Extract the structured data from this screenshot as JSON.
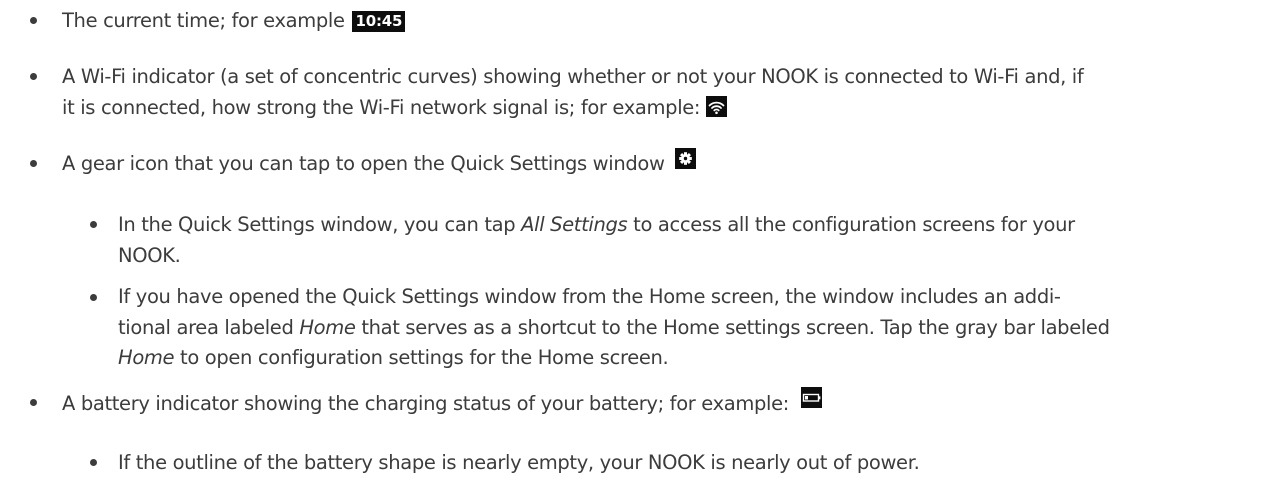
{
  "items": [
    {
      "text": "The current time; for example ",
      "badge": "10:45"
    },
    {
      "line1": "A Wi-Fi indicator (a set of concentric curves) showing whether or not your NOOK is connected to Wi-Fi and, if",
      "line2": "it is connected, how strong the Wi-Fi network signal is; for example:",
      "icon": "wifi-icon"
    },
    {
      "text": "A gear icon that you can tap to open the Quick Settings window",
      "icon": "gear-icon"
    },
    {
      "a": "In the Quick Settings window, you can tap ",
      "em": "All Settings",
      "b": " to access all the configuration screens for your",
      "line2": "NOOK."
    },
    {
      "line1a": "If you have opened the Quick Settings window from the Home screen, the window includes an addi-",
      "line2a": "tional area labeled ",
      "line2em": "Home",
      "line2b": " that serves as a shortcut to the Home settings screen. Tap the gray bar labeled",
      "line3em": "Home",
      "line3b": " to open configuration settings for the Home screen."
    },
    {
      "text": "A battery indicator showing the charging status of your battery; for example:",
      "icon": "battery-icon"
    },
    {
      "text": "If the outline of the battery shape is nearly empty, your NOOK is nearly out of power."
    }
  ]
}
